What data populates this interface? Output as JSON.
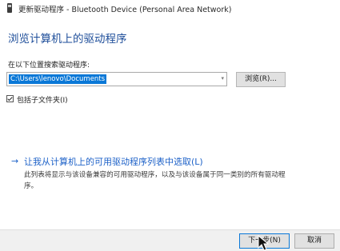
{
  "window": {
    "title": "更新驱动程序 - Bluetooth Device (Personal Area Network)",
    "icon": "device-manager-icon"
  },
  "main": {
    "heading": "浏览计算机上的驱动程序",
    "search_label": "在以下位置搜索驱动程序:",
    "path_value": "C:\\Users\\lenovo\\Documents",
    "browse_label": "浏览(R)...",
    "include_subfolders_label": "包括子文件夹(I)",
    "include_subfolders_checked": true
  },
  "pick_option": {
    "arrow": "→",
    "title": "让我从计算机上的可用驱动程序列表中选取(L)",
    "description": "此列表将显示与该设备兼容的可用驱动程序，以及与该设备属于同一类别的所有驱动程序。"
  },
  "footer": {
    "next_label": "下一步(N)",
    "cancel_label": "取消"
  },
  "colors": {
    "heading": "#1e4e9a",
    "link": "#1e62c8",
    "selection": "#0a78d7"
  }
}
